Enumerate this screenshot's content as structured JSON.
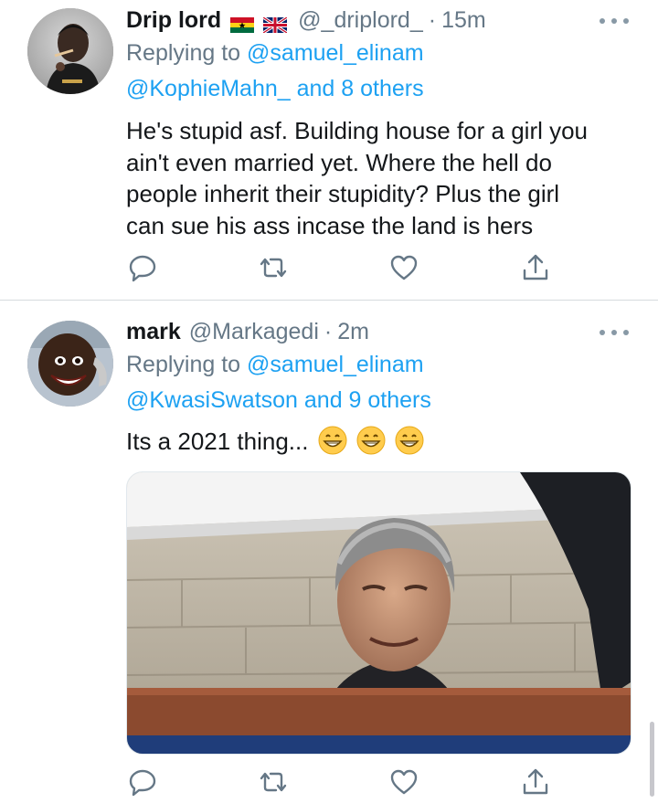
{
  "tweets": [
    {
      "name": "Drip lord",
      "handle": "@_driplord_",
      "dot": "·",
      "time": "15m",
      "replying_prefix": "Replying to",
      "replying_to": "@samuel_elinam",
      "also_replying": "@KophieMahn_ and 8 others",
      "text_lines": [
        "He's stupid asf. Building house for a girl you",
        "ain't even married yet. Where the hell do",
        "people inherit their stupidity? Plus the girl",
        "can sue his ass incase the land is hers"
      ],
      "flags": [
        "ghana-flag-icon",
        "uk-flag-icon"
      ]
    },
    {
      "name": "mark",
      "handle": "@Markagedi",
      "dot": "·",
      "time": "2m",
      "replying_prefix": "Replying to",
      "replying_to": "@samuel_elinam",
      "also_replying": "@KwasiSwatson and 9 others",
      "text_lines": [
        "Its a 2021 thing..."
      ],
      "emojis": [
        "grinning-face-icon",
        "grinning-face-icon",
        "grinning-face-icon"
      ]
    }
  ],
  "actions": [
    "reply-icon",
    "retweet-icon",
    "like-icon",
    "share-icon"
  ],
  "colors": {
    "accent": "#1da1f2",
    "secondary_text": "#657786",
    "primary_text": "#14171a",
    "divider": "#d6dadd"
  }
}
